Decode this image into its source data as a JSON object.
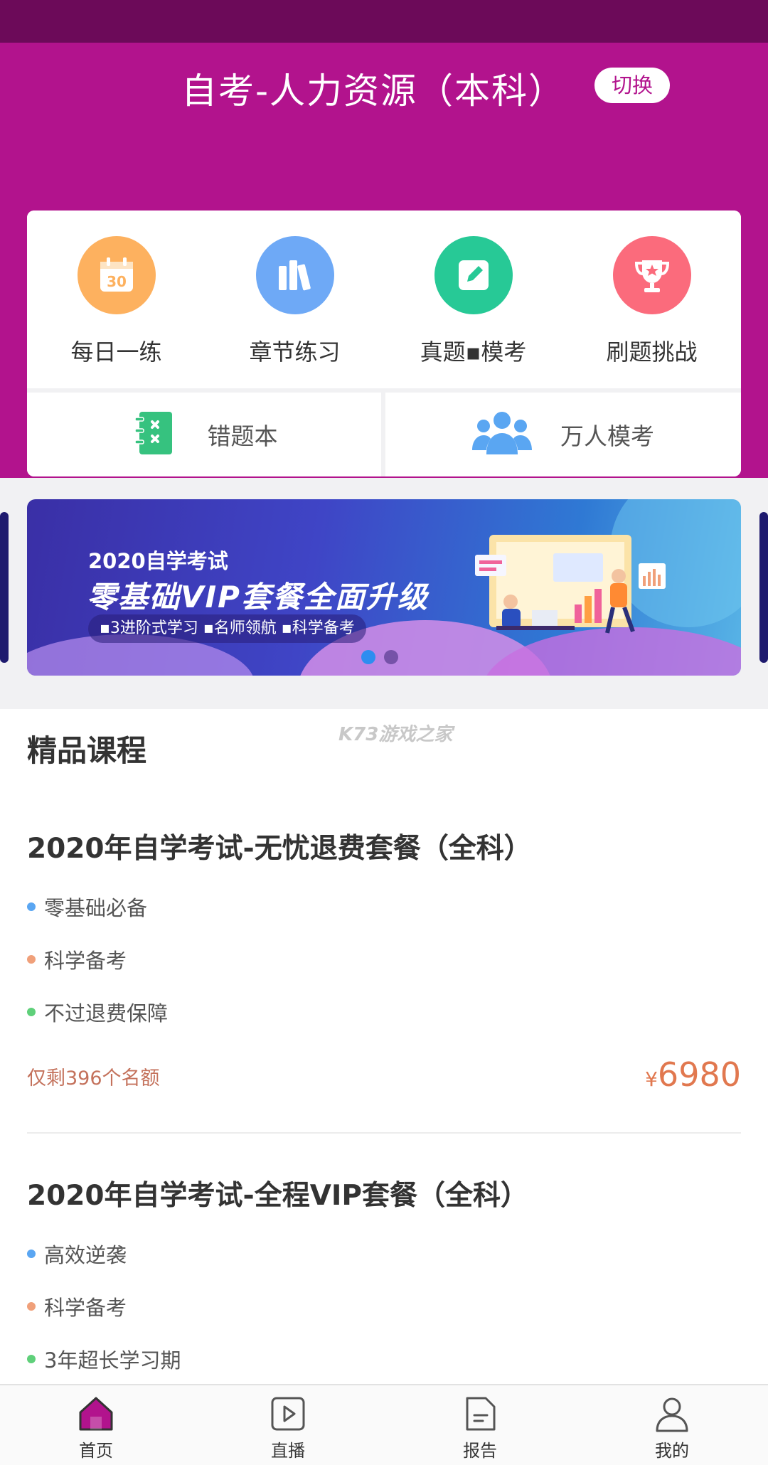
{
  "header": {
    "title": "自考-人力资源（本科）",
    "switch_label": "切换"
  },
  "quick_actions": [
    {
      "label": "每日一练",
      "icon": "calendar-icon",
      "color": "#fdb15f"
    },
    {
      "label": "章节练习",
      "icon": "books-icon",
      "color": "#6ea9f6"
    },
    {
      "label": "真题▪模考",
      "icon": "edit-icon",
      "color": "#27c996"
    },
    {
      "label": "刷题挑战",
      "icon": "trophy-icon",
      "color": "#fb6b7c"
    }
  ],
  "secondary_actions": [
    {
      "label": "错题本",
      "icon": "notebook-icon",
      "color": "#36c27f"
    },
    {
      "label": "万人模考",
      "icon": "group-icon",
      "color": "#5aa6f2"
    }
  ],
  "banner": {
    "subtitle": "2020自学考试",
    "title": "零基础VIP套餐全面升级",
    "tags": "▪3进阶式学习  ▪名师领航  ▪科学备考",
    "active_dot": 0,
    "dot_count": 2
  },
  "section_title": "精品课程",
  "watermark": "K73游戏之家",
  "courses": [
    {
      "title": "2020年自学考试-无忧退费套餐（全科）",
      "features": [
        {
          "text": "零基础必备",
          "color": "#5aa6f2"
        },
        {
          "text": "科学备考",
          "color": "#f0a07a"
        },
        {
          "text": "不过退费保障",
          "color": "#5fd07a"
        }
      ],
      "quota": "仅剩396个名额",
      "currency": "¥",
      "price": "6980"
    },
    {
      "title": "2020年自学考试-全程VIP套餐（全科）",
      "features": [
        {
          "text": "高效逆袭",
          "color": "#5aa6f2"
        },
        {
          "text": "科学备考",
          "color": "#f0a07a"
        },
        {
          "text": "3年超长学习期",
          "color": "#5fd07a"
        }
      ]
    }
  ],
  "tabbar": [
    {
      "label": "首页",
      "icon": "home-icon",
      "active": true
    },
    {
      "label": "直播",
      "icon": "play-icon",
      "active": false
    },
    {
      "label": "报告",
      "icon": "report-icon",
      "active": false
    },
    {
      "label": "我的",
      "icon": "user-icon",
      "active": false
    }
  ],
  "colors": {
    "brand": "#b2138d",
    "status_bar": "#6c0a59",
    "price": "#e1784f"
  }
}
